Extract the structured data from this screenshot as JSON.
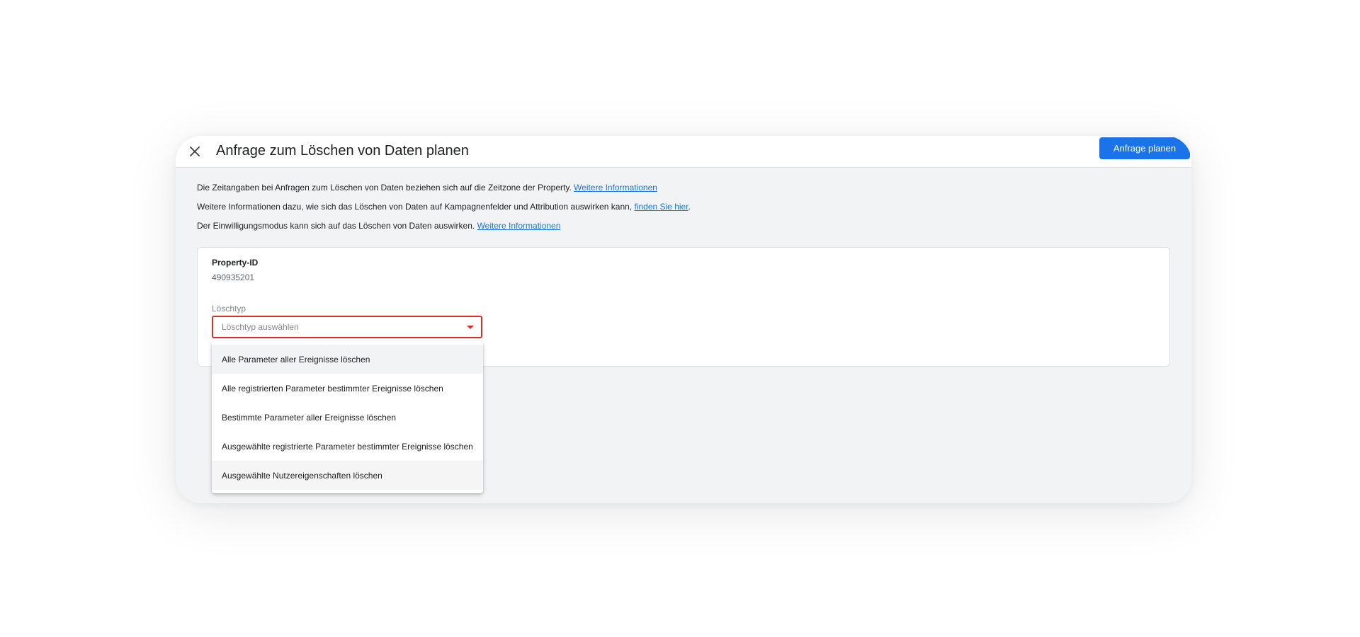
{
  "dialog": {
    "title": "Anfrage zum Löschen von Daten planen",
    "close_icon": "close-icon",
    "primary_button": "Anfrage planen"
  },
  "info": [
    {
      "text": "Die Zeitangaben bei Anfragen zum Löschen von Daten beziehen sich auf die Zeitzone der Property. ",
      "link": "Weitere Informationen",
      "suffix": ""
    },
    {
      "text": "Weitere Informationen dazu, wie sich das Löschen von Daten auf Kampagnenfelder und Attribution auswirken kann, ",
      "link": "finden Sie hier",
      "suffix": "."
    },
    {
      "text": "Der Einwilligungsmodus kann sich auf das Löschen von Daten auswirken. ",
      "link": "Weitere Informationen",
      "suffix": ""
    }
  ],
  "form": {
    "property_label": "Property-ID",
    "property_value": "490935201",
    "delete_type_label": "Löschtyp",
    "delete_type_placeholder": "Löschtyp auswählen",
    "dropdown_icon": "caret-down-icon"
  },
  "menu": {
    "options": [
      "Alle Parameter aller Ereignisse löschen",
      "Alle registrierten Parameter bestimmter Ereignisse löschen",
      "Bestimmte Parameter aller Ereignisse löschen",
      "Ausgewählte registrierte Parameter bestimmter Ereignisse löschen",
      "Ausgewählte Nutzereigenschaften löschen"
    ]
  },
  "colors": {
    "primary": "#1a73e8",
    "error": "#d93025",
    "dialog_bg": "#f1f3f4"
  }
}
